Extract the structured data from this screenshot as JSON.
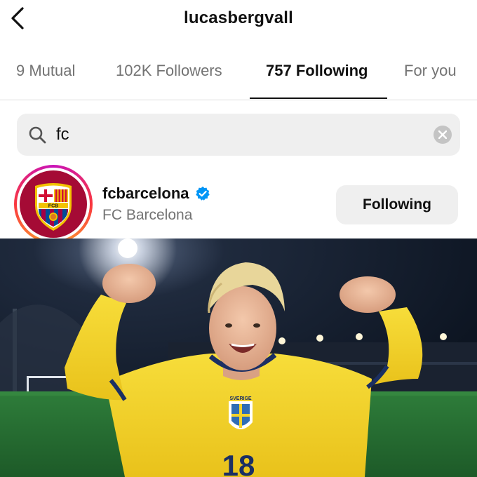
{
  "header": {
    "title": "lucasbergvall",
    "back_icon": "chevron-left-icon"
  },
  "tabs": [
    {
      "label": "9 Mutual",
      "active": false
    },
    {
      "label": "102K Followers",
      "active": false
    },
    {
      "label": "757 Following",
      "active": true
    },
    {
      "label": "For you",
      "active": false
    }
  ],
  "search": {
    "value": "fc",
    "icon": "search-icon",
    "clear_icon": "clear-icon"
  },
  "results": [
    {
      "username": "fcbarcelona",
      "full_name": "FC Barcelona",
      "verified": true,
      "button_label": "Following",
      "avatar": {
        "logo_text": "FCB",
        "ring": "story-gradient"
      }
    }
  ],
  "photo": {
    "jersey_number": "18",
    "badge_text": "SVERIGE",
    "description": "player in yellow Sweden kit celebrating on a lit football pitch at night"
  },
  "colors": {
    "text": "#111111",
    "muted": "#737373",
    "search_bg": "#efefef",
    "verified": "#0095f6",
    "barca_red": "#a50b35",
    "barca_blue": "#004d98",
    "jersey_yellow": "#f4d22a"
  }
}
